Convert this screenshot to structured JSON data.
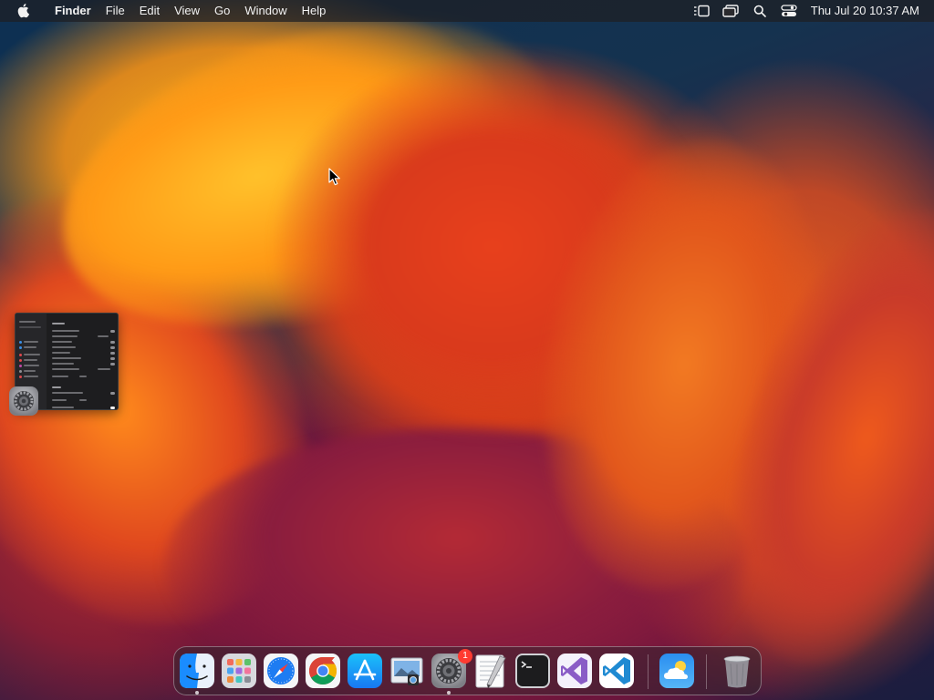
{
  "menubar": {
    "app_name": "Finder",
    "menus": [
      "File",
      "Edit",
      "View",
      "Go",
      "Window",
      "Help"
    ],
    "status_icons": [
      "stage-manager-icon",
      "screen-mirroring-icon",
      "spotlight-search-icon",
      "control-center-icon"
    ],
    "clock": "Thu Jul 20  10:37 AM"
  },
  "desktop": {
    "wallpaper": "macOS Ventura orange",
    "minimized_window": {
      "app": "System Settings",
      "icon": "gear-icon"
    }
  },
  "dock": {
    "items": [
      {
        "name": "Finder",
        "icon": "finder-icon",
        "running": true
      },
      {
        "name": "Launchpad",
        "icon": "launchpad-icon",
        "running": false
      },
      {
        "name": "Safari",
        "icon": "safari-compass-icon",
        "running": false
      },
      {
        "name": "Google Chrome",
        "icon": "chrome-icon",
        "running": false
      },
      {
        "name": "App Store",
        "icon": "app-store-icon",
        "running": false
      },
      {
        "name": "Preview",
        "icon": "preview-icon",
        "running": false
      },
      {
        "name": "System Settings",
        "icon": "gear-icon",
        "running": true,
        "badge": "1"
      },
      {
        "name": "TextEdit",
        "icon": "textedit-icon",
        "running": false
      },
      {
        "name": "Terminal",
        "icon": "terminal-icon",
        "running": false
      },
      {
        "name": "Visual Studio",
        "icon": "visual-studio-icon",
        "running": false
      },
      {
        "name": "Visual Studio Code",
        "icon": "vscode-icon",
        "running": false
      },
      {
        "name": "Weather",
        "icon": "weather-icon",
        "running": false
      },
      {
        "name": "Trash",
        "icon": "trash-icon",
        "running": false
      }
    ]
  },
  "colors": {
    "menubar_bg": "#1e1e22",
    "badge": "#ff3b30",
    "safari_blue": "#1e7cf2",
    "vscode_blue": "#1f8ad2",
    "vs_purple": "#8a5cc6"
  }
}
